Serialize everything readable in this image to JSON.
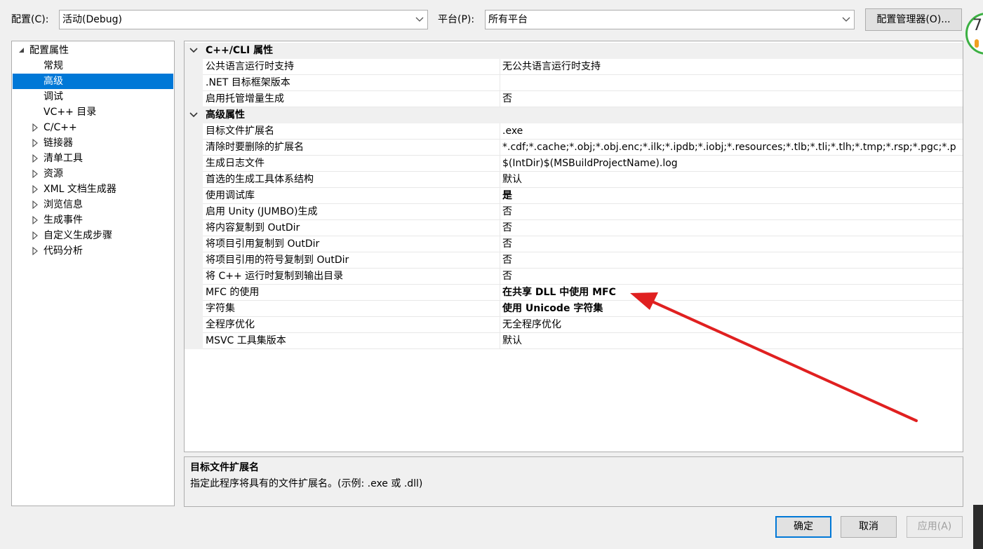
{
  "toolbar": {
    "config_label": "配置(C):",
    "config_value": "活动(Debug)",
    "platform_label": "平台(P):",
    "platform_value": "所有平台",
    "config_manager_button": "配置管理器(O)...",
    "side_badge": "7"
  },
  "tree": {
    "root_label": "配置属性",
    "items": [
      {
        "label": "常规",
        "expandable": false,
        "selected": false
      },
      {
        "label": "高级",
        "expandable": false,
        "selected": true
      },
      {
        "label": "调试",
        "expandable": false,
        "selected": false
      },
      {
        "label": "VC++ 目录",
        "expandable": false,
        "selected": false
      },
      {
        "label": "C/C++",
        "expandable": true,
        "selected": false
      },
      {
        "label": "链接器",
        "expandable": true,
        "selected": false
      },
      {
        "label": "清单工具",
        "expandable": true,
        "selected": false
      },
      {
        "label": "资源",
        "expandable": true,
        "selected": false
      },
      {
        "label": "XML 文档生成器",
        "expandable": true,
        "selected": false
      },
      {
        "label": "浏览信息",
        "expandable": true,
        "selected": false
      },
      {
        "label": "生成事件",
        "expandable": true,
        "selected": false
      },
      {
        "label": "自定义生成步骤",
        "expandable": true,
        "selected": false
      },
      {
        "label": "代码分析",
        "expandable": true,
        "selected": false
      }
    ]
  },
  "grid": {
    "rows": [
      {
        "kind": "category",
        "name": "C++/CLI 属性"
      },
      {
        "kind": "prop",
        "name": "公共语言运行时支持",
        "value": "无公共语言运行时支持",
        "bold": false
      },
      {
        "kind": "prop",
        "name": ".NET 目标框架版本",
        "value": "",
        "bold": false
      },
      {
        "kind": "prop",
        "name": "启用托管增量生成",
        "value": "否",
        "bold": false
      },
      {
        "kind": "category",
        "name": "高级属性"
      },
      {
        "kind": "prop",
        "name": "目标文件扩展名",
        "value": ".exe",
        "bold": false
      },
      {
        "kind": "prop",
        "name": "清除时要删除的扩展名",
        "value": "*.cdf;*.cache;*.obj;*.obj.enc;*.ilk;*.ipdb;*.iobj;*.resources;*.tlb;*.tli;*.tlh;*.tmp;*.rsp;*.pgc;*.p",
        "bold": false
      },
      {
        "kind": "prop",
        "name": "生成日志文件",
        "value": "$(IntDir)$(MSBuildProjectName).log",
        "bold": false
      },
      {
        "kind": "prop",
        "name": "首选的生成工具体系结构",
        "value": "默认",
        "bold": false
      },
      {
        "kind": "prop",
        "name": "使用调试库",
        "value": "是",
        "bold": true
      },
      {
        "kind": "prop",
        "name": "启用 Unity (JUMBO)生成",
        "value": "否",
        "bold": false
      },
      {
        "kind": "prop",
        "name": "将内容复制到 OutDir",
        "value": "否",
        "bold": false
      },
      {
        "kind": "prop",
        "name": "将项目引用复制到 OutDir",
        "value": "否",
        "bold": false
      },
      {
        "kind": "prop",
        "name": "将项目引用的符号复制到 OutDir",
        "value": "否",
        "bold": false
      },
      {
        "kind": "prop",
        "name": "将 C++ 运行时复制到输出目录",
        "value": "否",
        "bold": false
      },
      {
        "kind": "prop",
        "name": "MFC 的使用",
        "value": "在共享 DLL 中使用 MFC",
        "bold": true
      },
      {
        "kind": "prop",
        "name": "字符集",
        "value": "使用 Unicode 字符集",
        "bold": true
      },
      {
        "kind": "prop",
        "name": "全程序优化",
        "value": "无全程序优化",
        "bold": false
      },
      {
        "kind": "prop",
        "name": "MSVC 工具集版本",
        "value": "默认",
        "bold": false
      }
    ]
  },
  "description": {
    "title": "目标文件扩展名",
    "text": "指定此程序将具有的文件扩展名。(示例: .exe 或 .dll)"
  },
  "buttons": {
    "ok": "确定",
    "cancel": "取消",
    "apply": "应用(A)"
  },
  "colors": {
    "selection": "#0078d7",
    "annotation_arrow": "#e02020",
    "ok_border": "#0078d7",
    "badge_ring": "#3cb043"
  },
  "annotation": {
    "type": "arrow",
    "points_to": "MFC 的使用"
  }
}
